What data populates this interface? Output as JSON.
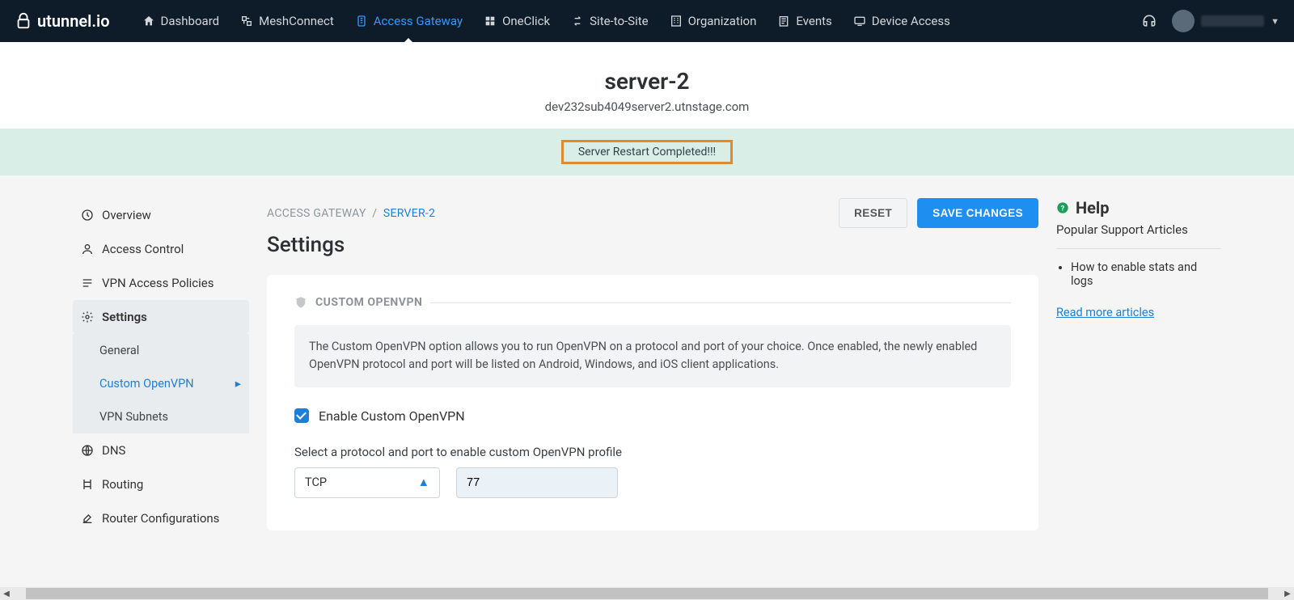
{
  "brand": "utunnel.io",
  "nav": {
    "items": [
      {
        "icon": "home",
        "label": "Dashboard"
      },
      {
        "icon": "mesh",
        "label": "MeshConnect"
      },
      {
        "icon": "gateway",
        "label": "Access Gateway",
        "active": true
      },
      {
        "icon": "oneclick",
        "label": "OneClick"
      },
      {
        "icon": "s2s",
        "label": "Site-to-Site"
      },
      {
        "icon": "org",
        "label": "Organization"
      },
      {
        "icon": "events",
        "label": "Events"
      },
      {
        "icon": "device",
        "label": "Device Access"
      }
    ]
  },
  "header": {
    "title": "server-2",
    "subtitle": "dev232sub4049server2.utnstage.com"
  },
  "alert": "Server Restart Completed!!!",
  "breadcrumb": {
    "root": "ACCESS GATEWAY",
    "current": "SERVER-2"
  },
  "buttons": {
    "reset": "RESET",
    "save": "SAVE CHANGES"
  },
  "page_title": "Settings",
  "sidebar": {
    "items": [
      {
        "icon": "overview",
        "label": "Overview"
      },
      {
        "icon": "access",
        "label": "Access Control"
      },
      {
        "icon": "policies",
        "label": "VPN Access Policies"
      },
      {
        "icon": "settings",
        "label": "Settings",
        "open": true,
        "children": [
          {
            "label": "General"
          },
          {
            "label": "Custom OpenVPN",
            "active": true
          },
          {
            "label": "VPN Subnets"
          }
        ]
      },
      {
        "icon": "dns",
        "label": "DNS"
      },
      {
        "icon": "routing",
        "label": "Routing"
      },
      {
        "icon": "router",
        "label": "Router Configurations"
      }
    ]
  },
  "section": {
    "title": "CUSTOM OPENVPN",
    "info": "The Custom OpenVPN option allows you to run OpenVPN on a protocol and port of your choice. Once enabled, the newly enabled OpenVPN protocol and port will be listed on Android, Windows, and iOS client applications.",
    "checkbox_label": "Enable Custom OpenVPN",
    "checkbox_checked": true,
    "field_label": "Select a protocol and port to enable custom OpenVPN profile",
    "protocol": "TCP",
    "port": "77"
  },
  "help": {
    "title": "Help",
    "subtitle": "Popular Support Articles",
    "articles": [
      "How to enable stats and logs"
    ],
    "more": "Read more articles"
  }
}
